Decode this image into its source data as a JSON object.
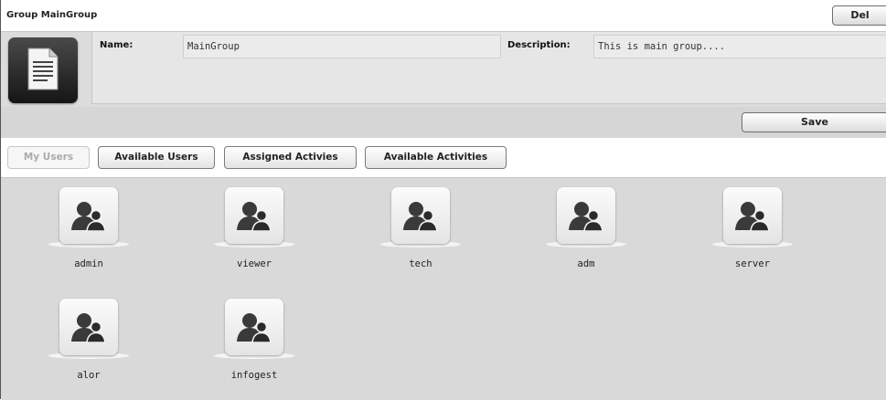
{
  "header": {
    "title": "Group MainGroup",
    "del_label": "Del"
  },
  "group": {
    "icon": "document-icon",
    "name_label": "Name:",
    "name_value": "MainGroup",
    "description_label": "Description:",
    "description_value": "This is main group...."
  },
  "actions": {
    "save_label": "Save"
  },
  "tabs": [
    {
      "label": "My Users",
      "active": true
    },
    {
      "label": "Available Users"
    },
    {
      "label": "Assigned Activies"
    },
    {
      "label": "Available Activities"
    }
  ],
  "users": [
    {
      "name": "admin",
      "icon": "user-icon"
    },
    {
      "name": "viewer",
      "icon": "user-icon"
    },
    {
      "name": "tech",
      "icon": "user-icon"
    },
    {
      "name": "adm",
      "icon": "user-icon"
    },
    {
      "name": "server",
      "icon": "user-icon"
    },
    {
      "name": "alor",
      "icon": "user-icon"
    },
    {
      "name": "infogest",
      "icon": "user-icon"
    }
  ]
}
